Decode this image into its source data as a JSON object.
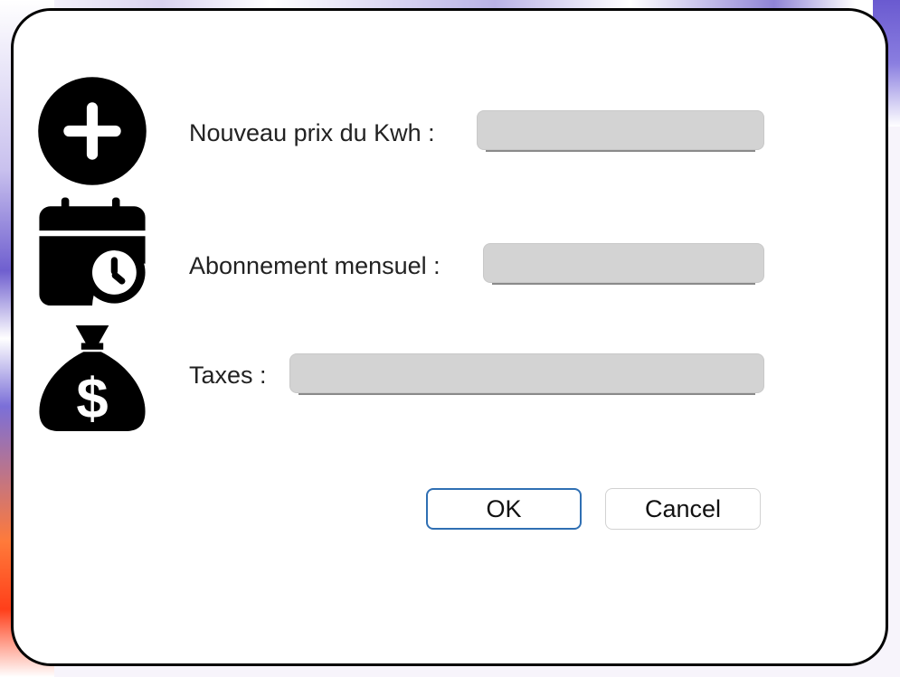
{
  "dialog": {
    "fields": [
      {
        "label": "Nouveau prix du Kwh :",
        "value": "",
        "icon": "add-circle-icon"
      },
      {
        "label": "Abonnement mensuel :",
        "value": "",
        "icon": "calendar-clock-icon"
      },
      {
        "label": "Taxes :",
        "value": "",
        "icon": "money-bag-icon"
      }
    ],
    "buttons": {
      "ok": "OK",
      "cancel": "Cancel"
    }
  },
  "colors": {
    "field_background": "#d3d3d3",
    "ok_border": "#2f6fb3",
    "icon": "#000000"
  }
}
